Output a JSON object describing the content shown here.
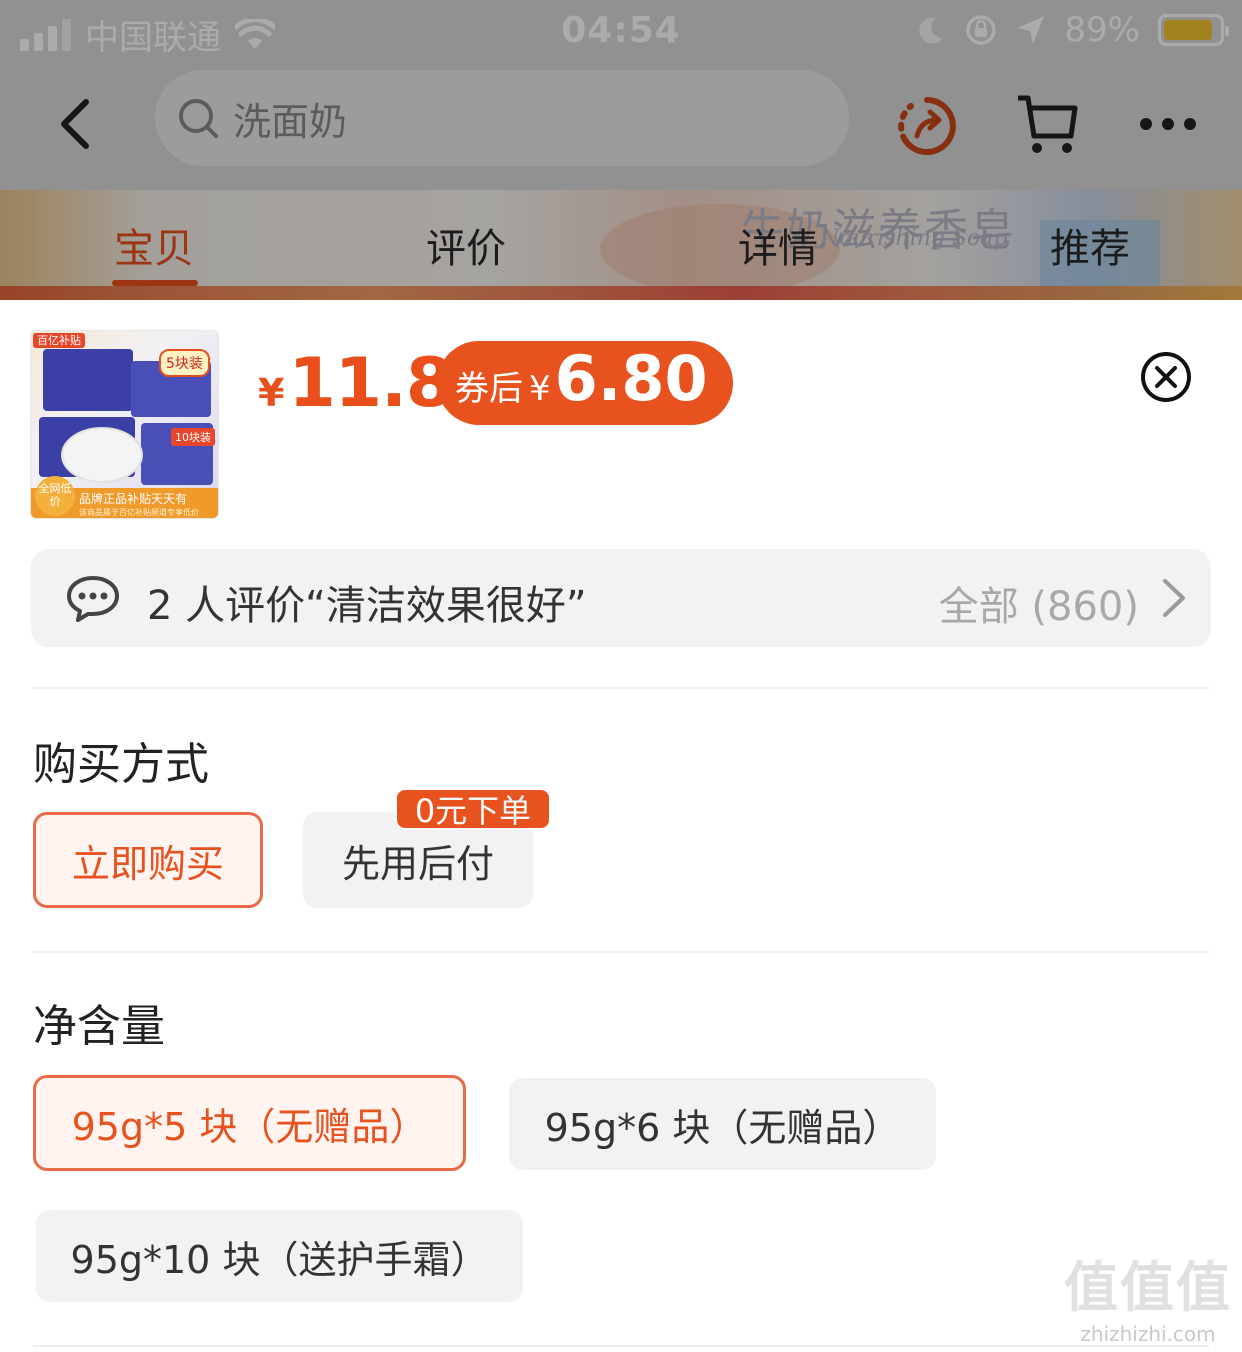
{
  "status_bar": {
    "carrier": "中国联通",
    "time": "04:54",
    "battery": "89%",
    "battery_level": 0.89,
    "battery_color": "#f4c430"
  },
  "nav": {
    "search_placeholder": "洗面奶",
    "icons": [
      "back-icon",
      "search-icon",
      "share-icon",
      "cart-icon",
      "more-icon"
    ]
  },
  "tabs": [
    {
      "label": "宝贝",
      "active": true
    },
    {
      "label": "评价",
      "active": false
    },
    {
      "label": "详情",
      "active": false
    },
    {
      "label": "推荐",
      "active": false
    }
  ],
  "banner": {
    "title": "牛奶滋养香皂",
    "subtitle": "Nourishing Soap"
  },
  "product": {
    "thumb_tag_top": "百亿补贴",
    "thumb_tag_pack5": "5块装",
    "thumb_tag_pack10": "10块装",
    "thumb_low_price": "全网低价",
    "thumb_footer": "品牌正品补贴天天有",
    "thumb_footer_small": "该商品属于百亿补贴频道专享低价",
    "price_symbol": "¥",
    "price": "11.8",
    "coupon_prefix": "券后",
    "coupon_symbol": "¥",
    "coupon_price": "6.80"
  },
  "review": {
    "text": "2 人评价“清洁效果很好”",
    "all_label": "全部 (860)"
  },
  "purchase": {
    "title": "购买方式",
    "options": [
      {
        "label": "立即购买",
        "selected": true
      },
      {
        "label": "先用后付",
        "selected": false
      }
    ],
    "badge": "0元下单"
  },
  "volume": {
    "title": "净含量",
    "options": [
      {
        "label": "95g*5 块（无赠品）",
        "selected": true
      },
      {
        "label": "95g*6 块（无赠品）",
        "selected": false
      },
      {
        "label": "95g*10 块（送护手霜）",
        "selected": false
      }
    ]
  },
  "watermark": {
    "glyphs": "值值值",
    "domain": "zhizhizhi.com"
  },
  "colors": {
    "accent": "#e8521f",
    "price": "#e84f1b",
    "chip_bg": "#f2f2f2"
  }
}
